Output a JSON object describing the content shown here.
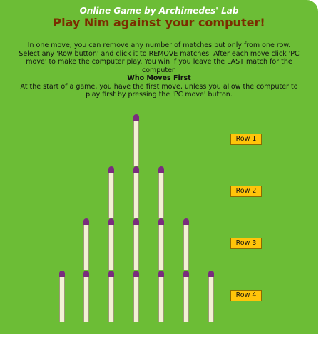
{
  "header": {
    "subtitle": "Online Game by Archimedes' Lab",
    "title": "Play Nim against your computer!"
  },
  "instructions": {
    "paragraph1": "In one move, you can remove any number of matches but only from one row. Select any 'Row button' and click it to REMOVE matches. After each move click 'PC move' to make the computer play. You win if you leave the LAST match for the computer.",
    "heading": "Who Moves First",
    "paragraph2": "At the start of a game, you have the first move, unless you allow the computer to play first by pressing the 'PC move' button."
  },
  "rows": [
    {
      "label": "Row 1",
      "matches": 1
    },
    {
      "label": "Row 2",
      "matches": 3
    },
    {
      "label": "Row 3",
      "matches": 5
    },
    {
      "label": "Row 4",
      "matches": 7
    }
  ],
  "colors": {
    "background": "#6cbd36",
    "title": "#7a2e00",
    "match_head": "#7a2d7e",
    "match_stick": "#f2f1d4",
    "button": "#ffc40a"
  }
}
